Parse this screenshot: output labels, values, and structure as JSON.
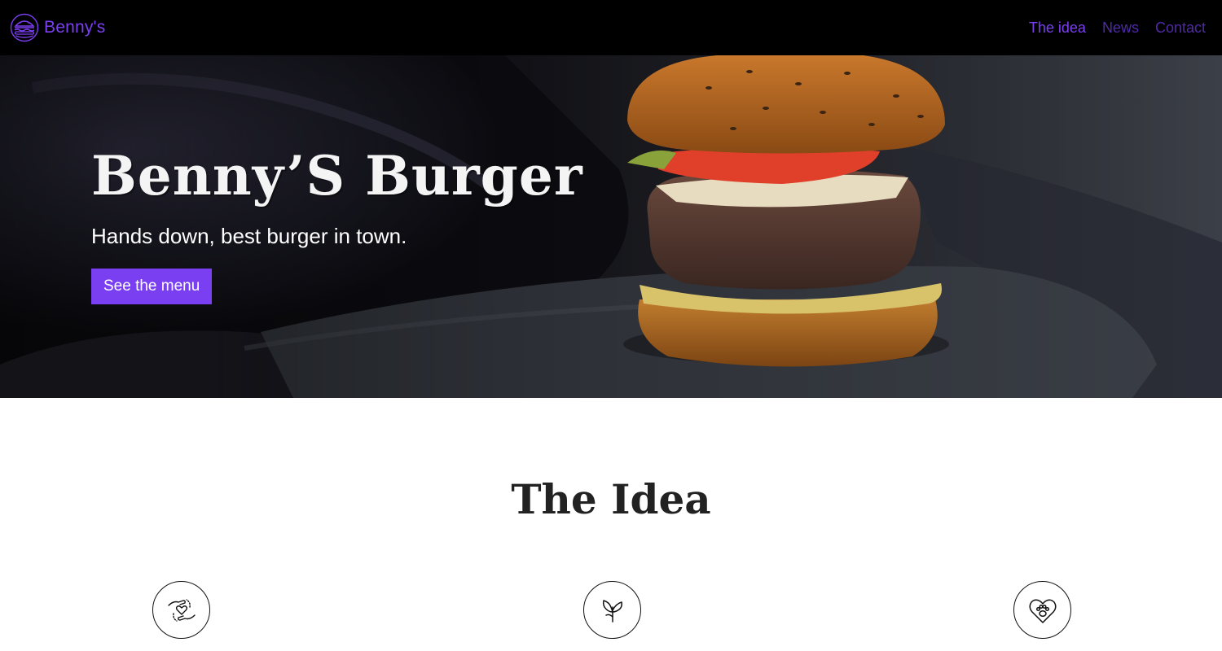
{
  "colors": {
    "accent": "#7b3ff2",
    "nav_dim": "#4f2aa6",
    "navbar_bg": "#000000"
  },
  "navbar": {
    "brand_name": "Benny's",
    "brand_icon": "burger-icon",
    "links": [
      {
        "label": "The idea",
        "active": true
      },
      {
        "label": "News",
        "active": false
      },
      {
        "label": "Contact",
        "active": false
      }
    ]
  },
  "hero": {
    "title": "Benny’S Burger",
    "subtitle": "Hands down, best burger in town.",
    "button_label": "See the menu"
  },
  "idea": {
    "title": "The Idea",
    "features": [
      {
        "icon": "hands-heart-icon"
      },
      {
        "icon": "plant-sprout-icon"
      },
      {
        "icon": "heart-paw-icon"
      }
    ]
  }
}
